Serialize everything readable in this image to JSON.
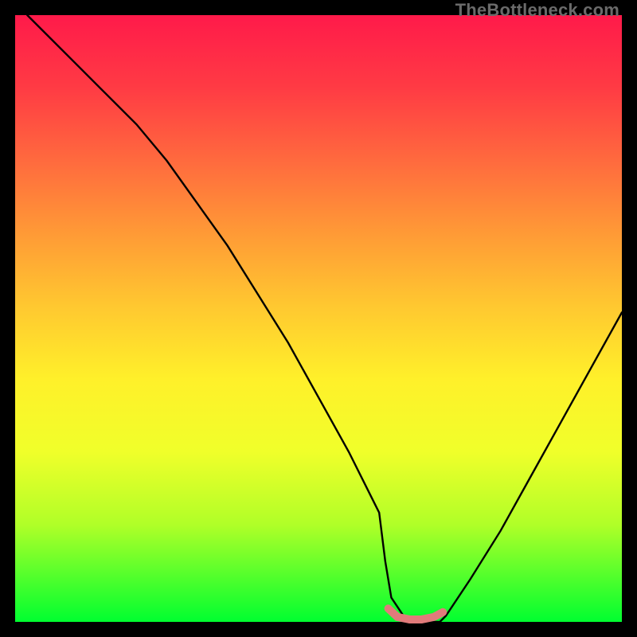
{
  "watermark": "TheBottleneck.com",
  "chart_data": {
    "type": "line",
    "title": "",
    "xlabel": "",
    "ylabel": "",
    "xlim": [
      0,
      100
    ],
    "ylim": [
      0,
      100
    ],
    "series": [
      {
        "name": "curve",
        "x": [
          2,
          5,
          10,
          15,
          20,
          25,
          30,
          35,
          40,
          45,
          50,
          55,
          60,
          61,
          62,
          64,
          67,
          70,
          71,
          75,
          80,
          85,
          90,
          95,
          100
        ],
        "y": [
          100,
          97,
          92,
          87,
          82,
          76,
          69,
          62,
          54,
          46,
          37,
          28,
          18,
          10,
          4,
          1,
          0,
          0,
          1,
          7,
          15,
          24,
          33,
          42,
          51
        ]
      }
    ],
    "highlight": {
      "name": "bottom-segment",
      "color": "#e17b7b",
      "x": [
        61.5,
        63,
        65,
        67,
        69,
        70.5
      ],
      "y": [
        2.2,
        0.8,
        0.4,
        0.4,
        0.8,
        1.6
      ]
    }
  }
}
